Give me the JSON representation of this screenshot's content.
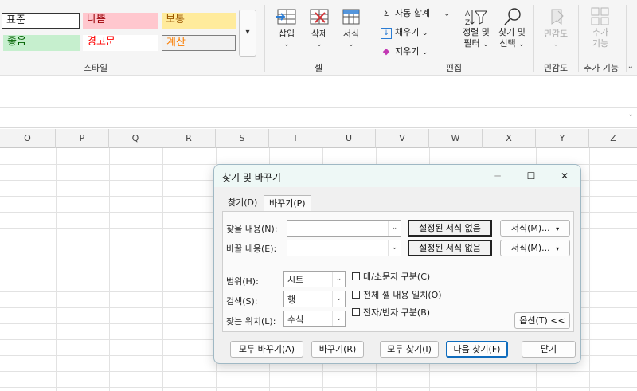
{
  "ribbon": {
    "styles_group": {
      "label": "스타일",
      "cells": [
        {
          "name": "standard",
          "label": "표준",
          "bg": "#ffffff",
          "fg": "#111111"
        },
        {
          "name": "bad",
          "label": "나쁨",
          "bg": "#ffc7ce",
          "fg": "#9c0006"
        },
        {
          "name": "neutral",
          "label": "보통",
          "bg": "#ffeb9c",
          "fg": "#9c5700"
        },
        {
          "name": "good",
          "label": "좋음",
          "bg": "#c6efce",
          "fg": "#006100"
        },
        {
          "name": "warning",
          "label": "경고문",
          "bg": "#ffffff",
          "fg": "#ff0000"
        },
        {
          "name": "calculation",
          "label": "계산",
          "bg": "#f2f2f2",
          "fg": "#fa7d00"
        }
      ],
      "more_glyph": "▾"
    },
    "cells_group": {
      "label": "셀",
      "insert": "삽입",
      "delete": "삭제",
      "format": "서식"
    },
    "editing_group": {
      "label": "편집",
      "autosum": "자동 합계",
      "fill": "채우기",
      "clear": "지우기",
      "sort_line1": "정렬 및",
      "sort_line2": "필터",
      "find_line1": "찾기 및",
      "find_line2": "선택"
    },
    "sensitivity_group": {
      "label": "민감도",
      "button": "민감도"
    },
    "addins_group": {
      "label": "추가 기능",
      "button_line1": "추가",
      "button_line2": "기능"
    }
  },
  "columns": [
    "O",
    "P",
    "Q",
    "R",
    "S",
    "T",
    "U",
    "V",
    "W",
    "X",
    "Y",
    "Z"
  ],
  "dialog": {
    "title": "찾기 및 바꾸기",
    "controls": {
      "minimize": "─",
      "maximize": "☐",
      "close": "✕"
    },
    "tabs": {
      "find": "찾기(D)",
      "replace": "바꾸기(P)"
    },
    "find_what_label": "찾을 내용(N):",
    "find_what_value": "",
    "replace_with_label": "바꿀 내용(E):",
    "replace_with_value": "",
    "no_format_set": "설정된 서식 없음",
    "format_button": "서식(M)...",
    "within_label": "범위(H):",
    "within_value": "시트",
    "search_label": "검색(S):",
    "search_value": "행",
    "look_in_label": "찾는 위치(L):",
    "look_in_value": "수식",
    "match_case": "대/소문자 구분(C)",
    "match_entire": "전체 셀 내용 일치(O)",
    "match_byte": "전자/반자 구분(B)",
    "options_button": "옵션(T) <<",
    "replace_all": "모두 바꾸기(A)",
    "replace": "바꾸기(R)",
    "find_all": "모두 찾기(I)",
    "find_next": "다음 찾기(F)",
    "close": "닫기"
  },
  "colors": {
    "accent": "#0f6cbd",
    "insert_icon": "#2b7cd3",
    "delete_icon": "#d13438"
  }
}
